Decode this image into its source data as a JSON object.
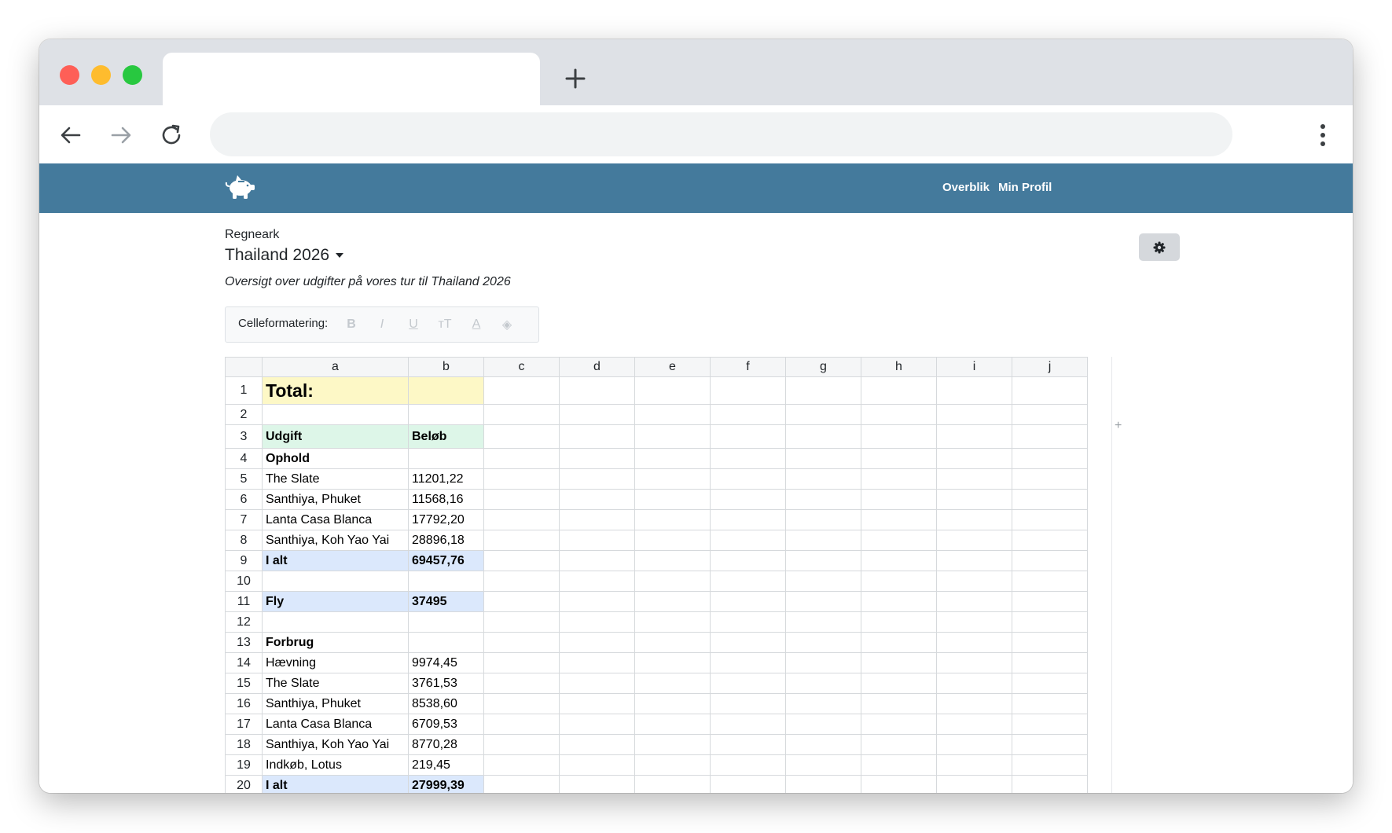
{
  "browser": {
    "tab_title": "",
    "address": "",
    "new_tab_icon": "plus-icon",
    "back_icon": "arrow-left-icon",
    "forward_icon": "arrow-right-icon",
    "reload_icon": "reload-icon",
    "menu_icon": "kebab-menu-icon"
  },
  "app": {
    "logo_icon": "piggy-bank-icon",
    "nav": {
      "overview": "Overblik",
      "profile": "Min Profil"
    },
    "colors": {
      "nav_bg": "#447a9c",
      "title_fill": "#fdf8c6",
      "header_fill": "#ddf6e8",
      "total_fill": "#dbe8fc"
    }
  },
  "sheet": {
    "label": "Regneark",
    "title": "Thailand 2026",
    "description": "Oversigt over udgifter på vores tur til Thailand 2026",
    "settings_icon": "gear-icon"
  },
  "format_bar": {
    "label": "Celleformatering:",
    "buttons": [
      {
        "name": "bold",
        "glyph": "B"
      },
      {
        "name": "italic",
        "glyph": "I"
      },
      {
        "name": "underline",
        "glyph": "U"
      },
      {
        "name": "text-size",
        "glyph": "тT"
      },
      {
        "name": "text-color",
        "glyph": "A"
      },
      {
        "name": "fill-color",
        "glyph": "◈"
      }
    ]
  },
  "grid": {
    "columns": [
      "a",
      "b",
      "c",
      "d",
      "e",
      "f",
      "g",
      "h",
      "i",
      "j"
    ],
    "add_column": "+",
    "rows": [
      {
        "n": "1",
        "a": "Total:",
        "b": "",
        "style": "title"
      },
      {
        "n": "2",
        "a": "",
        "b": ""
      },
      {
        "n": "3",
        "a": "Udgift",
        "b": "Beløb",
        "style": "header"
      },
      {
        "n": "4",
        "a": "Ophold",
        "b": "",
        "style": "section"
      },
      {
        "n": "5",
        "a": "The Slate",
        "b": "11201,22"
      },
      {
        "n": "6",
        "a": "Santhiya, Phuket",
        "b": "11568,16"
      },
      {
        "n": "7",
        "a": "Lanta Casa Blanca",
        "b": "17792,20"
      },
      {
        "n": "8",
        "a": "Santhiya, Koh Yao Yai",
        "b": "28896,18"
      },
      {
        "n": "9",
        "a": "I alt",
        "b": "69457,76",
        "style": "total"
      },
      {
        "n": "10",
        "a": "",
        "b": ""
      },
      {
        "n": "11",
        "a": "Fly",
        "b": "37495",
        "style": "total"
      },
      {
        "n": "12",
        "a": "",
        "b": ""
      },
      {
        "n": "13",
        "a": "Forbrug",
        "b": "",
        "style": "section"
      },
      {
        "n": "14",
        "a": "Hævning",
        "b": "9974,45"
      },
      {
        "n": "15",
        "a": "The Slate",
        "b": "3761,53"
      },
      {
        "n": "16",
        "a": "Santhiya, Phuket",
        "b": "8538,60"
      },
      {
        "n": "17",
        "a": "Lanta Casa Blanca",
        "b": "6709,53"
      },
      {
        "n": "18",
        "a": "Santhiya, Koh Yao Yai",
        "b": "8770,28"
      },
      {
        "n": "19",
        "a": "Indkøb, Lotus",
        "b": "219,45"
      },
      {
        "n": "20",
        "a": "I alt",
        "b": "27999,39",
        "style": "total"
      }
    ]
  }
}
